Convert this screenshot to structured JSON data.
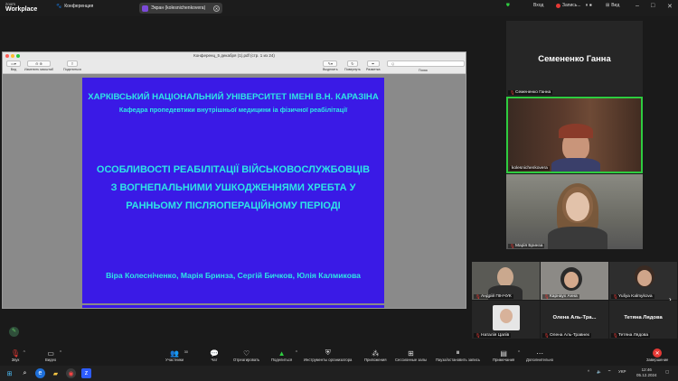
{
  "app": {
    "brand_small": "zoom",
    "brand_big": "Workplace",
    "conference_tab": "Конференция",
    "screen_share_label": "Экран (kolesnichenkovera)",
    "login_label": "Вход",
    "record_label": "Запись...",
    "view_label": "Вид"
  },
  "document": {
    "window_title": "Конференц_5 декабря (1).pdf (стр. 1 из 24)",
    "toolbar": {
      "view_label": "Вид",
      "zoom_label": "Изменить масштаб",
      "share_label": "Поделиться",
      "highlight_label": "Выделить",
      "rotate_label": "Повернуть",
      "annotate_label": "Разметка",
      "search_label": "Поиск",
      "search_placeholder": "Q"
    },
    "slide": {
      "university": "ХАРКІВСЬКИЙ НАЦІОНАЛЬНИЙ УНІВЕРСИТЕТ ІМЕНІ В.Н. КАРАЗІНА",
      "department": "Кафедра пропедевтики внутрішньої медицини іа фізичної реабілітації",
      "title_line1": "ОСОБЛИВОСТІ РЕАБІЛІТАЦІЇ ВІЙСЬКОВОСЛУЖБОВЦІВ",
      "title_line2": "З ВОГНЕПАЛЬНИМИ УШКОДЖЕННЯМИ ХРЕБТА У",
      "title_line3": "РАННЬОМУ ПІСЛЯОПЕРАЦІЙНОМУ ПЕРІОДІ",
      "authors": "Віра Колесніченко, Марія Бринза, Сергій Бичков, Юлія Калмикова",
      "bg_color": "#3a1ae6",
      "text_color": "#2ee6e6"
    }
  },
  "participants": {
    "big": [
      {
        "display": "Семененко Ганна",
        "label": "Семененко Ганна"
      },
      {
        "display": "",
        "label": "kolesnichenkovera"
      },
      {
        "display": "",
        "label": "Марія Бринза"
      }
    ],
    "small_row1": [
      {
        "label": "Андрій ПІНЧУК"
      },
      {
        "label": "Карнаух Анна"
      },
      {
        "label": "Yuliya Kalmykova"
      }
    ],
    "small_row2": [
      {
        "display": "",
        "label": "Наталія Цапів"
      },
      {
        "display": "Олена Аль-Тра...",
        "label": "Олена Аль-Травнех"
      },
      {
        "display": "Тетяна Лядова",
        "label": "Тетяна Лядова"
      }
    ],
    "active_speaker_color": "#2ecc40"
  },
  "toolbar": {
    "audio": "Звук",
    "video": "Видео",
    "participants": "Участники",
    "participants_count": "30",
    "chat": "Чат",
    "react": "Отреагировать",
    "share": "Поделиться",
    "host_tools": "Инструменты организатора",
    "apps": "Приложения",
    "breakout": "Сессионные залы",
    "pause_share": "Пауза/остановить запись",
    "notes": "Примечания",
    "more": "Дополнительно",
    "end": "Завершение"
  },
  "taskbar": {
    "language": "УКР",
    "time": "12:46",
    "date": "05.12.2024"
  }
}
